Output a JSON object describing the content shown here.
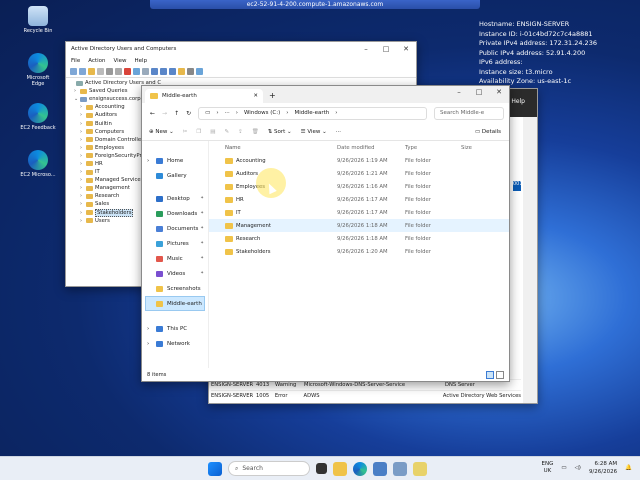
{
  "rdp": {
    "title": "ec2-52-91-4-200.compute-1.amazonaws.com"
  },
  "desktop": {
    "icons": [
      {
        "label": "Recycle Bin"
      },
      {
        "label": "Microsoft Edge"
      },
      {
        "label": "EC2 Feedback"
      },
      {
        "label": "EC2 Microso..."
      }
    ],
    "bginfo": {
      "lines": [
        "Hostname: ENSIGN-SERVER",
        "Instance ID: i-01c4bd72c7c4a8881",
        "Private IPv4 address: 172.31.24.236",
        "Public IPv4 address: 52.91.4.200",
        "IPv6 address:",
        "Instance size: t3.micro",
        "Availability Zone: us-east-1c"
      ]
    }
  },
  "aduc": {
    "title": "Active Directory Users and Computers",
    "menu": [
      "File",
      "Action",
      "View",
      "Help"
    ],
    "tree": [
      {
        "label": "Active Directory Users and C",
        "arrow": "",
        "indent": 0
      },
      {
        "label": "Saved Queries",
        "arrow": ">",
        "indent": 1
      },
      {
        "label": "ensignsuccess.corp",
        "arrow": "v",
        "indent": 1
      },
      {
        "label": "Accounting",
        "arrow": ">",
        "indent": 2
      },
      {
        "label": "Auditors",
        "arrow": ">",
        "indent": 2
      },
      {
        "label": "Builtin",
        "arrow": ">",
        "indent": 2
      },
      {
        "label": "Computers",
        "arrow": ">",
        "indent": 2
      },
      {
        "label": "Domain Controller",
        "arrow": ">",
        "indent": 2
      },
      {
        "label": "Employees",
        "arrow": ">",
        "indent": 2
      },
      {
        "label": "ForeignSecurityPri",
        "arrow": ">",
        "indent": 2
      },
      {
        "label": "HR",
        "arrow": ">",
        "indent": 2
      },
      {
        "label": "IT",
        "arrow": ">",
        "indent": 2
      },
      {
        "label": "Managed Service A",
        "arrow": ">",
        "indent": 2
      },
      {
        "label": "Management",
        "arrow": ">",
        "indent": 2
      },
      {
        "label": "Research",
        "arrow": ">",
        "indent": 2
      },
      {
        "label": "Sales",
        "arrow": ">",
        "indent": 2
      },
      {
        "label": "Stakeholders",
        "arrow": ">",
        "indent": 2,
        "selected": true
      },
      {
        "label": "Users",
        "arrow": ">",
        "indent": 2
      }
    ]
  },
  "server_manager": {
    "help": "Help",
    "right_badge": "001",
    "events": [
      {
        "server": "ENSIGN-SERVER",
        "id": "4013",
        "severity": "Warning",
        "source": "Microsoft-Windows-DNS-Server-Service",
        "log": "DNS Server"
      },
      {
        "server": "ENSIGN-SERVER",
        "id": "1005",
        "severity": "Error",
        "source": "ADWS",
        "log": "Active Directory Web Services"
      }
    ]
  },
  "explorer": {
    "tab_title": "Middle-earth",
    "address": {
      "drive": "Windows (C:)",
      "folder": "Middle-earth"
    },
    "search_placeholder": "Search Middle-e",
    "commands": {
      "new": "New",
      "sort": "Sort",
      "view": "View",
      "details": "Details"
    },
    "sidebar": [
      {
        "label": "Home",
        "color": "#3a7bd5",
        "pin": false
      },
      {
        "label": "Gallery",
        "color": "#2e8bd8",
        "pin": false
      },
      {
        "label": "Desktop",
        "color": "#2d6fc9",
        "pin": true
      },
      {
        "label": "Downloads",
        "color": "#2a9d5c",
        "pin": true
      },
      {
        "label": "Documents",
        "color": "#4a7fd6",
        "pin": true
      },
      {
        "label": "Pictures",
        "color": "#3aa1d9",
        "pin": true
      },
      {
        "label": "Music",
        "color": "#e2574c",
        "pin": true
      },
      {
        "label": "Videos",
        "color": "#7a4fd0",
        "pin": true
      },
      {
        "label": "Screenshots",
        "color": "#f0c349",
        "pin": false
      },
      {
        "label": "Middle-earth",
        "color": "#f0c349",
        "pin": false,
        "selected": true
      },
      {
        "label": "This PC",
        "color": "#3a7bd5",
        "pin": false
      },
      {
        "label": "Network",
        "color": "#3a7bd5",
        "pin": false
      }
    ],
    "columns": {
      "name": "Name",
      "date": "Date modified",
      "type": "Type",
      "size": "Size"
    },
    "files": [
      {
        "name": "Accounting",
        "date": "9/26/2026 1:19 AM",
        "type": "File folder"
      },
      {
        "name": "Auditors",
        "date": "9/26/2026 1:21 AM",
        "type": "File folder"
      },
      {
        "name": "Employees",
        "date": "9/26/2026 1:16 AM",
        "type": "File folder"
      },
      {
        "name": "HR",
        "date": "9/26/2026 1:17 AM",
        "type": "File folder"
      },
      {
        "name": "IT",
        "date": "9/26/2026 1:17 AM",
        "type": "File folder"
      },
      {
        "name": "Management",
        "date": "9/26/2026 1:18 AM",
        "type": "File folder",
        "hover": true
      },
      {
        "name": "Research",
        "date": "9/26/2026 1:18 AM",
        "type": "File folder"
      },
      {
        "name": "Stakeholders",
        "date": "9/26/2026 1:20 AM",
        "type": "File folder"
      }
    ],
    "status": "8 items"
  },
  "taskbar": {
    "search_label": "Search",
    "lang": [
      "ENG",
      "UK"
    ],
    "time": "6:28 AM",
    "date": "9/26/2026"
  }
}
